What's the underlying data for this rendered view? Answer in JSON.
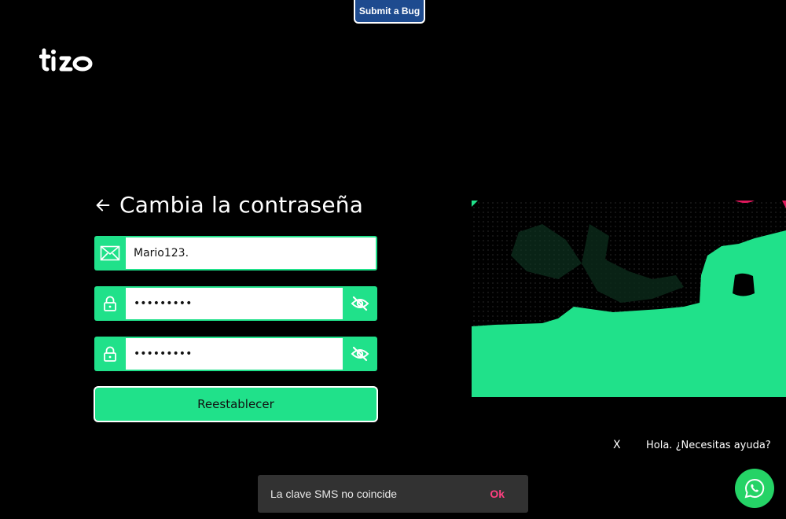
{
  "debug": {
    "submit_bug_label": "Submit a Bug"
  },
  "header": {
    "logo_icon": "tizo-logo"
  },
  "form": {
    "title": "Cambia la contraseña",
    "back_icon": "arrow-left-icon",
    "fields": [
      {
        "icon": "mail-icon",
        "type": "text",
        "value": "Mario123."
      },
      {
        "icon": "lock-icon",
        "type": "password",
        "value": "•••••••••",
        "toggle_icon": "eye-off-icon"
      },
      {
        "icon": "lock-icon",
        "type": "password",
        "value": "•••••••••",
        "toggle_icon": "eye-off-icon"
      }
    ],
    "submit_label": "Reestablecer"
  },
  "chat": {
    "close_label": "X",
    "prompt": "Hola. ¿Necesitas ayuda?",
    "icon": "whatsapp-icon"
  },
  "toast": {
    "message": "La clave SMS no coincide",
    "action_label": "Ok"
  },
  "colors": {
    "accent": "#20e18a",
    "background": "#000000",
    "bug_button": "#1e4b8f",
    "toast_action": "#ff4081",
    "whatsapp": "#25d366"
  }
}
